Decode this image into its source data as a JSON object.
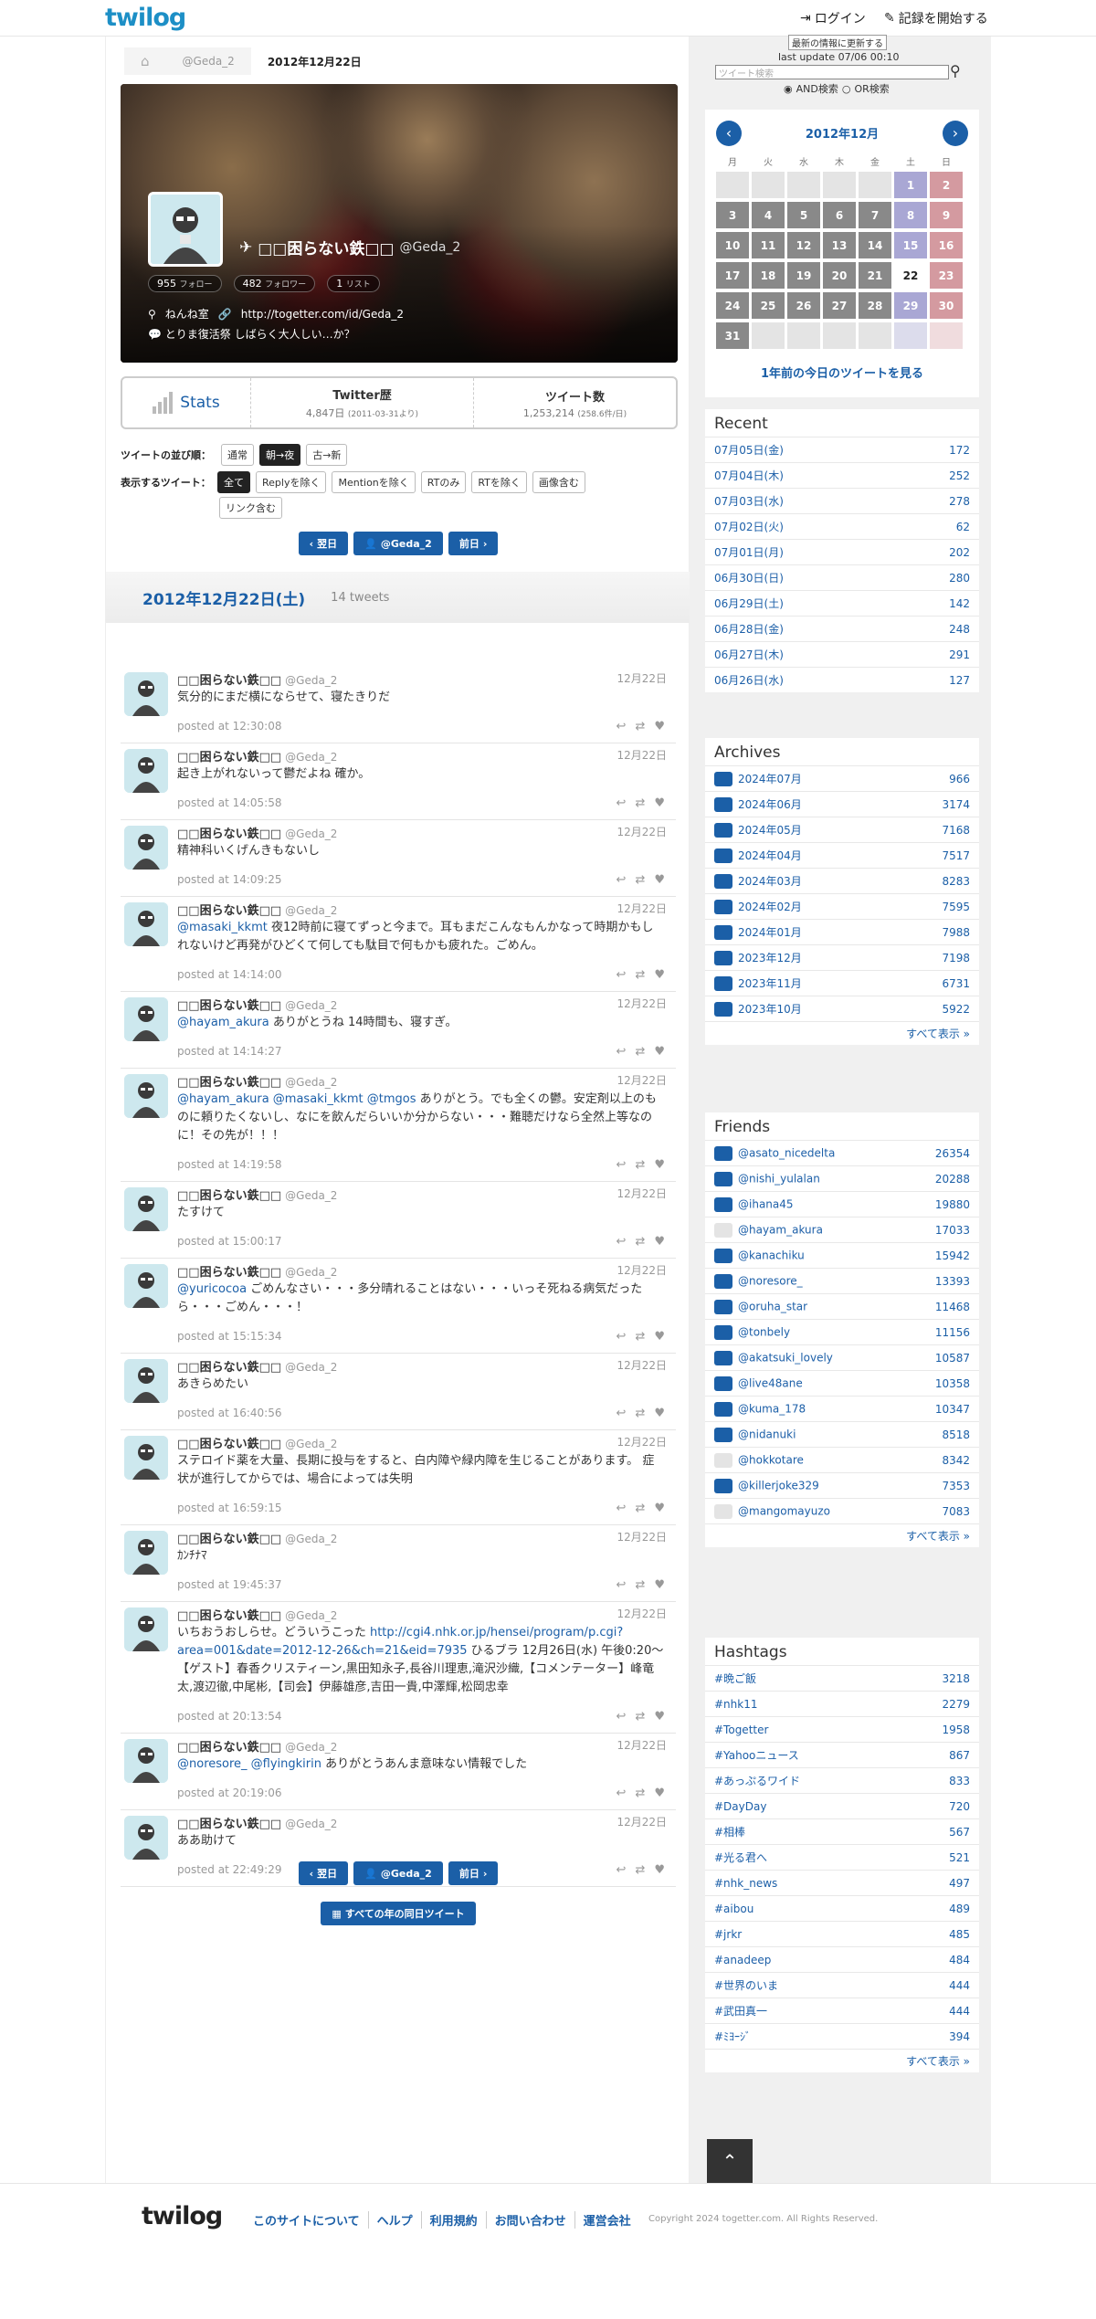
{
  "header": {
    "logo": "twilog",
    "login": "ログイン",
    "start": "記録を開始する"
  },
  "breadcrumb": {
    "home_icon": "home-icon",
    "user": "@Geda_2",
    "date": "2012年12月22日"
  },
  "profile": {
    "name": "□□困らない鉄□□",
    "handle": "@Geda_2",
    "follow_count": "955",
    "follow_label": "フォロー",
    "follower_count": "482",
    "follower_label": "フォロワー",
    "list_count": "1",
    "list_label": "リスト",
    "location": "ねんね室",
    "url": "http://togetter.com/id/Geda_2",
    "bio": "とりま復活祭 しばらく大人しい…か？"
  },
  "stats": {
    "label": "Stats",
    "history_title": "Twitter歴",
    "history_value": "4,847日",
    "history_sub": "(2011-03-31より)",
    "count_title": "ツイート数",
    "count_value": "1,253,214",
    "count_sub": "(258.6件/日)"
  },
  "order": {
    "label": "ツイートの並び順：",
    "opts": [
      "通常",
      "朝→夜",
      "古→新"
    ]
  },
  "display": {
    "label": "表示するツイート：",
    "opts": [
      "全て",
      "Replyを除く",
      "Mentionを除く",
      "RTのみ",
      "RTを除く",
      "画像含む",
      "リンク含む"
    ]
  },
  "nav": {
    "prev": "翌日",
    "user": "@Geda_2",
    "next": "前日",
    "all_years": "すべての年の同日ツイート"
  },
  "day": {
    "title": "2012年12月22日(土)",
    "count": "14 tweets"
  },
  "tweets": [
    {
      "name": "□□困らない鉄□□",
      "handle": "@Geda_2",
      "date": "12月22日",
      "text": "気分的にまだ横にならせて、寝たきりだ",
      "posted": "posted at 12:30:08"
    },
    {
      "name": "□□困らない鉄□□",
      "handle": "@Geda_2",
      "date": "12月22日",
      "text": "起き上がれないって鬱だよね 確か。",
      "posted": "posted at 14:05:58"
    },
    {
      "name": "□□困らない鉄□□",
      "handle": "@Geda_2",
      "date": "12月22日",
      "text": "精神科いくげんきもないし",
      "posted": "posted at 14:09:25"
    },
    {
      "name": "□□困らない鉄□□",
      "handle": "@Geda_2",
      "date": "12月22日",
      "mention": "@masaki_kkmt",
      "text": " 夜12時前に寝てずっと今まで。耳もまだこんなもんかなって時期かもしれないけど再発がひどくて何しても駄目で何もかも疲れた。ごめん。",
      "posted": "posted at 14:14:00"
    },
    {
      "name": "□□困らない鉄□□",
      "handle": "@Geda_2",
      "date": "12月22日",
      "mention": "@hayam_akura",
      "text": " ありがとうね 14時間も、寝すぎ。",
      "posted": "posted at 14:14:27"
    },
    {
      "name": "□□困らない鉄□□",
      "handle": "@Geda_2",
      "date": "12月22日",
      "mention": "@hayam_akura @masaki_kkmt @tmgos",
      "text": " ありがとう。でも全くの鬱。安定剤以上のものに頼りたくないし、なにを飲んだらいいか分からない・・・難聴だけなら全然上等なのに！その先が！！！",
      "posted": "posted at 14:19:58"
    },
    {
      "name": "□□困らない鉄□□",
      "handle": "@Geda_2",
      "date": "12月22日",
      "text": "たすけて",
      "posted": "posted at 15:00:17"
    },
    {
      "name": "□□困らない鉄□□",
      "handle": "@Geda_2",
      "date": "12月22日",
      "mention": "@yuricocoa",
      "text": " ごめんなさい・・・多分晴れることはない・・・いっそ死ねる病気だったら・・・ごめん・・・！",
      "posted": "posted at 15:15:34"
    },
    {
      "name": "□□困らない鉄□□",
      "handle": "@Geda_2",
      "date": "12月22日",
      "text": "あきらめたい",
      "posted": "posted at 16:40:56"
    },
    {
      "name": "□□困らない鉄□□",
      "handle": "@Geda_2",
      "date": "12月22日",
      "text": "ステロイド薬を大量、長期に投与をすると、白内障や緑内障を生じることがあります。 症状が進行してからでは、場合によっては失明",
      "posted": "posted at 16:59:15"
    },
    {
      "name": "□□困らない鉄□□",
      "handle": "@Geda_2",
      "date": "12月22日",
      "text": "ｶﾝﾁﾅﾏ",
      "posted": "posted at 19:45:37"
    },
    {
      "name": "□□困らない鉄□□",
      "handle": "@Geda_2",
      "date": "12月22日",
      "pre": "いちおうおしらせ。どういうこった ",
      "link": "http://cgi4.nhk.or.jp/hensei/program/p.cgi?area=001&date=2012-12-26&ch=21&eid=7935",
      "text": " ひるブラ 12月26日(水) 午後0:20〜【ゲスト】春香クリスティーン,黒田知永子,長谷川理恵,滝沢沙織,【コメンテーター】峰竜太,渡辺徹,中尾彬,【司会】伊藤雄彦,吉田一貴,中澤輝,松岡忠幸",
      "posted": "posted at 20:13:54"
    },
    {
      "name": "□□困らない鉄□□",
      "handle": "@Geda_2",
      "date": "12月22日",
      "mention": "@noresore_ @flyingkirin",
      "text": " ありがとうあんま意味ない情報でした",
      "posted": "posted at 20:19:06"
    },
    {
      "name": "□□困らない鉄□□",
      "handle": "@Geda_2",
      "date": "12月22日",
      "text": "ああ助けて",
      "posted": "posted at 22:49:29"
    }
  ],
  "search": {
    "update_button": "最新の情報に更新する",
    "last_update": "last update 07/06 00:10",
    "placeholder": "ツイート検索",
    "and": "AND検索",
    "or": "OR検索"
  },
  "calendar": {
    "title": "2012年12月",
    "weekdays": [
      "月",
      "火",
      "水",
      "木",
      "金",
      "土",
      "日"
    ],
    "link": "1年前の今日のツイートを見る",
    "rows": [
      [
        "",
        "",
        "",
        "",
        "",
        "1",
        "2"
      ],
      [
        "3",
        "4",
        "5",
        "6",
        "7",
        "8",
        "9"
      ],
      [
        "10",
        "11",
        "12",
        "13",
        "14",
        "15",
        "16"
      ],
      [
        "17",
        "18",
        "19",
        "20",
        "21",
        "22",
        "23"
      ],
      [
        "24",
        "25",
        "26",
        "27",
        "28",
        "29",
        "30"
      ],
      [
        "31",
        "",
        "",
        "",
        "",
        "",
        ""
      ]
    ]
  },
  "recent": {
    "title": "Recent",
    "items": [
      [
        "07月05日(金)",
        "172"
      ],
      [
        "07月04日(木)",
        "252"
      ],
      [
        "07月03日(水)",
        "278"
      ],
      [
        "07月02日(火)",
        "62"
      ],
      [
        "07月01日(月)",
        "202"
      ],
      [
        "06月30日(日)",
        "280"
      ],
      [
        "06月29日(土)",
        "142"
      ],
      [
        "06月28日(金)",
        "248"
      ],
      [
        "06月27日(木)",
        "291"
      ],
      [
        "06月26日(水)",
        "127"
      ]
    ]
  },
  "archives": {
    "title": "Archives",
    "more": "すべて表示 »",
    "items": [
      [
        "2024年07月",
        "966"
      ],
      [
        "2024年06月",
        "3174"
      ],
      [
        "2024年05月",
        "7168"
      ],
      [
        "2024年04月",
        "7517"
      ],
      [
        "2024年03月",
        "8283"
      ],
      [
        "2024年02月",
        "7595"
      ],
      [
        "2024年01月",
        "7988"
      ],
      [
        "2023年12月",
        "7198"
      ],
      [
        "2023年11月",
        "6731"
      ],
      [
        "2023年10月",
        "5922"
      ]
    ]
  },
  "friends": {
    "title": "Friends",
    "more": "すべて表示 »",
    "items": [
      [
        "@asato_nicedelta",
        "26354"
      ],
      [
        "@nishi_yulalan",
        "20288"
      ],
      [
        "@ihana45",
        "19880"
      ],
      [
        "@hayam_akura",
        "17033"
      ],
      [
        "@kanachiku",
        "15942"
      ],
      [
        "@noresore_",
        "13393"
      ],
      [
        "@oruha_star",
        "11468"
      ],
      [
        "@tonbely",
        "11156"
      ],
      [
        "@akatsuki_lovely",
        "10587"
      ],
      [
        "@live48ane",
        "10358"
      ],
      [
        "@kuma_178",
        "10347"
      ],
      [
        "@nidanuki",
        "8518"
      ],
      [
        "@hokkotare",
        "8342"
      ],
      [
        "@killerjoke329",
        "7353"
      ],
      [
        "@mangomayuzo",
        "7083"
      ]
    ]
  },
  "hashtags": {
    "title": "Hashtags",
    "more": "すべて表示 »",
    "items": [
      [
        "#晩ご飯",
        "3218"
      ],
      [
        "#nhk11",
        "2279"
      ],
      [
        "#Togetter",
        "1958"
      ],
      [
        "#Yahooニュース",
        "867"
      ],
      [
        "#あっぷるワイド",
        "833"
      ],
      [
        "#DayDay",
        "720"
      ],
      [
        "#相棒",
        "567"
      ],
      [
        "#光る君へ",
        "521"
      ],
      [
        "#nhk_news",
        "497"
      ],
      [
        "#aibou",
        "489"
      ],
      [
        "#jrkr",
        "485"
      ],
      [
        "#anadeep",
        "484"
      ],
      [
        "#世界のいま",
        "444"
      ],
      [
        "#武田真一",
        "444"
      ],
      [
        "#ﾐﾖｰｼﾞ",
        "394"
      ]
    ]
  },
  "footer": {
    "logo": "twilog",
    "links": [
      "このサイトについて",
      "ヘルプ",
      "利用規約",
      "お問い合わせ",
      "運営会社"
    ],
    "copyright": "Copyright 2024 togetter.com. All Rights Reserved."
  }
}
